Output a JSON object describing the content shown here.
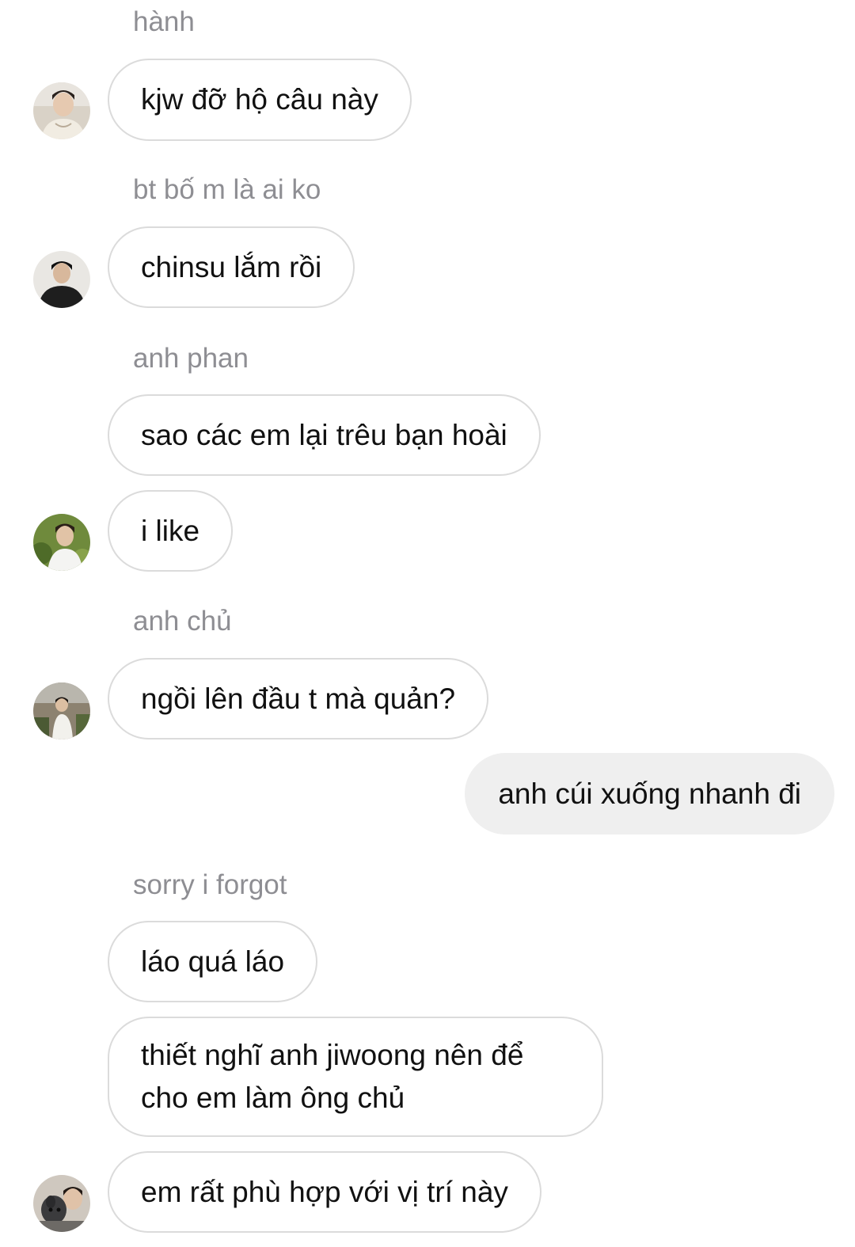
{
  "thread": {
    "groups": [
      {
        "sender": "hành",
        "messages": [
          "kjw đỡ hộ câu này"
        ]
      },
      {
        "sender": "bt bố m là ai ko",
        "messages": [
          "chinsu lắm rồi"
        ]
      },
      {
        "sender": "anh phan",
        "messages": [
          "sao các em lại trêu bạn hoài",
          "i like"
        ]
      },
      {
        "sender": "anh chủ",
        "messages": [
          "ngồi lên đầu t mà quản?"
        ]
      },
      {
        "sender": "sorry i forgot",
        "messages": [
          "láo quá láo",
          "thiết nghĩ anh jiwoong nên để cho em làm ông chủ",
          "em rất phù hợp với vị trí này"
        ]
      }
    ],
    "own_messages": [
      "anh cúi xuống nhanh đi"
    ]
  },
  "avatars": {
    "hanh": "avatar-photo",
    "bt": "avatar-photo",
    "anh_phan": "avatar-photo",
    "anh_chu": "avatar-photo",
    "sorry": "avatar-photo"
  },
  "colors": {
    "bubble_border": "#dbdbdb",
    "own_bubble_bg": "#efefef",
    "sender_text": "#8e8e93",
    "message_text": "#111111"
  }
}
